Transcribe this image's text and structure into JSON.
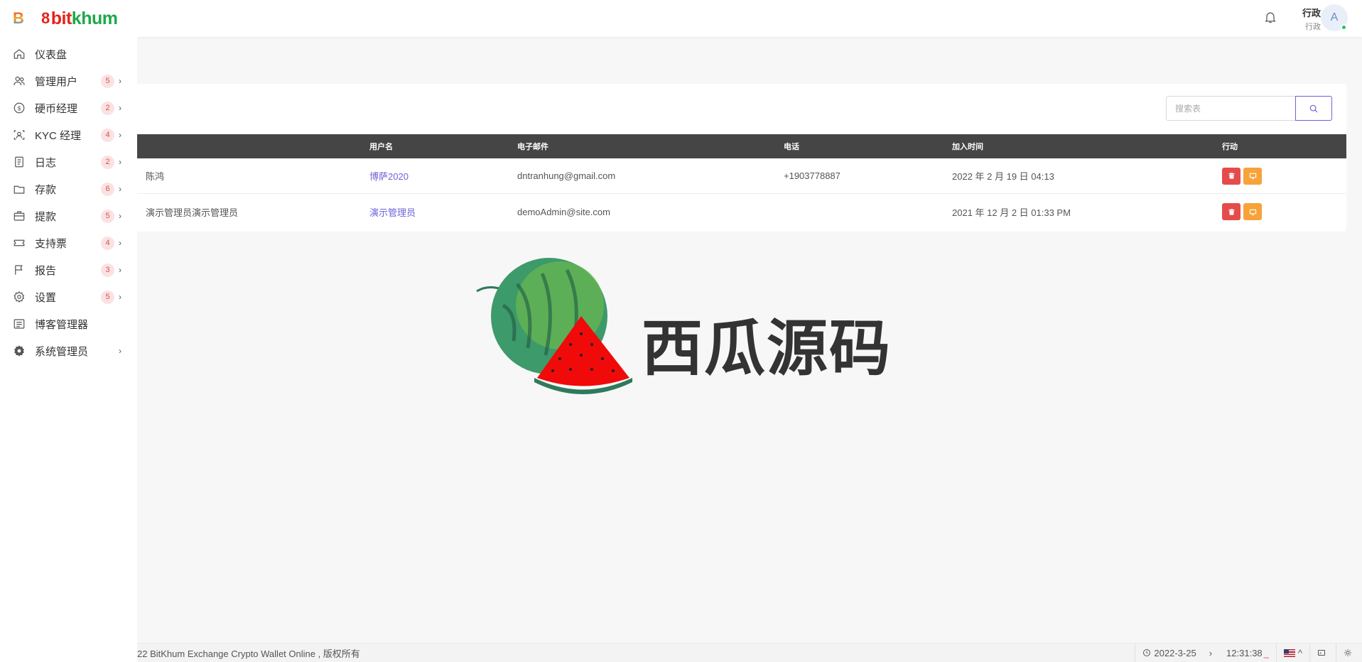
{
  "brand": {
    "prefix": "B",
    "logo_glyph": "8",
    "name_part1": "bit",
    "name_part2": "khum"
  },
  "sidebar": {
    "items": [
      {
        "label": "仪表盘",
        "icon": "home-icon",
        "badge": "",
        "chevron": false
      },
      {
        "label": "管理用户",
        "icon": "users-icon",
        "badge": "5",
        "chevron": true
      },
      {
        "label": "硬币经理",
        "icon": "coin-icon",
        "badge": "2",
        "chevron": true
      },
      {
        "label": "KYC 经理",
        "icon": "id-icon",
        "badge": "4",
        "chevron": true
      },
      {
        "label": "日志",
        "icon": "log-icon",
        "badge": "2",
        "chevron": true
      },
      {
        "label": "存款",
        "icon": "wallet-icon",
        "badge": "6",
        "chevron": true
      },
      {
        "label": "提款",
        "icon": "briefcase-icon",
        "badge": "5",
        "chevron": true
      },
      {
        "label": "支持票",
        "icon": "ticket-icon",
        "badge": "4",
        "chevron": true
      },
      {
        "label": "报告",
        "icon": "flag-icon",
        "badge": "3",
        "chevron": true
      },
      {
        "label": "设置",
        "icon": "gear-icon",
        "badge": "5",
        "chevron": true
      },
      {
        "label": "博客管理器",
        "icon": "list-icon",
        "badge": "",
        "chevron": false
      },
      {
        "label": "系统管理员",
        "icon": "cog-icon",
        "badge": "",
        "chevron": true
      }
    ]
  },
  "header": {
    "user_name": "行政",
    "user_role": "行政",
    "avatar_letter": "A"
  },
  "search": {
    "placeholder": "搜索表"
  },
  "table": {
    "columns": [
      "",
      "用户名",
      "电子邮件",
      "电话",
      "加入时间",
      "行动"
    ],
    "rows": [
      {
        "name": "陈鸿",
        "username": "博萨2020",
        "email": "dntranhung@gmail.com",
        "phone": "+1903778887",
        "joined": "2022 年 2 月 19 日 04:13"
      },
      {
        "name": "演示管理员演示管理员",
        "username": "演示管理员",
        "email": "demoAdmin@site.com",
        "phone": "",
        "joined": "2021 年 12 月 2 日 01:33 PM"
      }
    ]
  },
  "watermark": {
    "text": "西瓜源码"
  },
  "footer": {
    "copyright": "22  BitKhum Exchange Crypto Wallet Online , 版权所有",
    "date": "2022-3-25",
    "time": "12:31:38",
    "time_suffix": "_"
  },
  "colors": {
    "accent": "#6e63d9",
    "danger": "#e64b4b",
    "warning": "#f7a23a",
    "badge_bg": "#fbe2e2",
    "table_header": "#454545"
  }
}
